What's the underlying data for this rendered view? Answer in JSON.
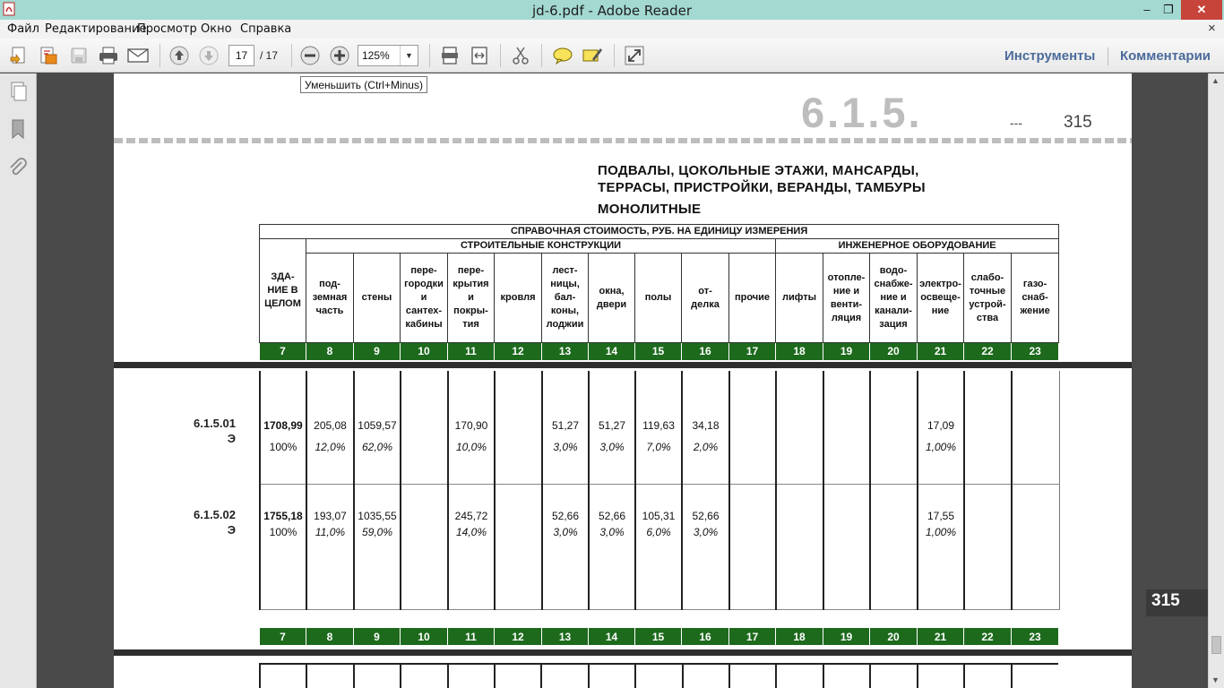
{
  "window": {
    "title": "jd-6.pdf - Adobe Reader",
    "min_label": "‒",
    "max_label": "❐",
    "close_label": "✕"
  },
  "menu": {
    "items": [
      "Файл",
      "Редактирование",
      "Просмотр",
      "Окно",
      "Справка"
    ],
    "doc_close": "×"
  },
  "toolbar": {
    "page_current": "17",
    "page_total": "/ 17",
    "zoom": "125%",
    "tools_label": "Инструменты",
    "comments_label": "Комментарии"
  },
  "tooltip": "Уменьшить (Ctrl+Minus)",
  "document": {
    "chapter": "6.1.5.",
    "page_dash": "---",
    "page_number": "315",
    "heading_line1": "ПОДВАЛЫ, ЦОКОЛЬНЫЕ ЭТАЖИ, МАНСАРДЫ,",
    "heading_line2": "ТЕРРАСЫ, ПРИСТРОЙКИ, ВЕРАНДЫ, ТАМБУРЫ",
    "heading_line3": "МОНОЛИТНЫЕ",
    "table_title": "СПРАВОЧНАЯ СТОИМОСТЬ, РУБ. НА ЕДИНИЦУ ИЗМЕРЕНИЯ",
    "group_construction": "СТРОИТЕЛЬНЫЕ КОНСТРУКЦИИ",
    "group_engineering": "ИНЖЕНЕРНОЕ ОБОРУДОВАНИЕ",
    "col_building": "ЗДА-\nНИЕ В\nЦЕЛОМ",
    "columns": [
      "под-\nземная\nчасть",
      "стены",
      "пере-\nгородки\nи\nсантех-\nкабины",
      "пере-\nкрытия\nи\nпокры-\nтия",
      "кровля",
      "лест-\nницы,\nбал-\nконы,\nлоджии",
      "окна,\nдвери",
      "полы",
      "от-\nделка",
      "прочие",
      "лифты",
      "отопле-\nние и\nвенти-\nляция",
      "водо-\nснабже-\nние и\nканали-\nзация",
      "электро-\nосвеще-\nние",
      "слабо-\nточные\nустрой-\nства",
      "газо-\nснаб-\nжение"
    ],
    "col_numbers": [
      "7",
      "8",
      "9",
      "10",
      "11",
      "12",
      "13",
      "14",
      "15",
      "16",
      "17",
      "18",
      "19",
      "20",
      "21",
      "22",
      "23"
    ],
    "rows": [
      {
        "code": "6.1.5.01",
        "code_suffix": "Э",
        "values": [
          "1708,99",
          "205,08",
          "1059,57",
          "",
          "170,90",
          "",
          "51,27",
          "51,27",
          "119,63",
          "34,18",
          "",
          "",
          "",
          "",
          "17,09",
          "",
          ""
        ],
        "percents": [
          "100%",
          "12,0%",
          "62,0%",
          "",
          "10,0%",
          "",
          "3,0%",
          "3,0%",
          "7,0%",
          "2,0%",
          "",
          "",
          "",
          "",
          "1,00%",
          "",
          ""
        ]
      },
      {
        "code": "6.1.5.02",
        "code_suffix": "Э",
        "values": [
          "1755,18",
          "193,07",
          "1035,55",
          "",
          "245,72",
          "",
          "52,66",
          "52,66",
          "105,31",
          "52,66",
          "",
          "",
          "",
          "",
          "17,55",
          "",
          ""
        ],
        "percents": [
          "100%",
          "11,0%",
          "59,0%",
          "",
          "14,0%",
          "",
          "3,0%",
          "3,0%",
          "6,0%",
          "3,0%",
          "",
          "",
          "",
          "",
          "1,00%",
          "",
          ""
        ]
      }
    ],
    "side_tab": "315"
  },
  "icons": [
    "pdf-app-icon",
    "create-pdf-icon",
    "combine-files-icon",
    "save-icon",
    "print-icon",
    "email-icon",
    "previous-page-icon",
    "next-page-icon",
    "zoom-out-icon",
    "zoom-in-icon",
    "fit-page-icon",
    "fit-width-icon",
    "cut-icon",
    "comment-icon",
    "highlight-icon",
    "fullscreen-icon",
    "pages-panel-icon",
    "bookmarks-icon",
    "attachments-icon"
  ]
}
